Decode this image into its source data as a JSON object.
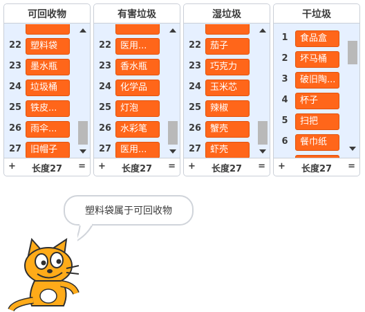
{
  "monitors": [
    {
      "title": "可回收物",
      "partial_label": "",
      "rows": [
        {
          "index": "22",
          "value": "塑料袋"
        },
        {
          "index": "23",
          "value": "墨水瓶"
        },
        {
          "index": "24",
          "value": "垃圾桶"
        },
        {
          "index": "25",
          "value": "铁皮..."
        },
        {
          "index": "26",
          "value": "雨伞..."
        },
        {
          "index": "27",
          "value": "旧帽子"
        }
      ],
      "footer": {
        "plus": "+",
        "length_label": "长度27",
        "equals": "="
      }
    },
    {
      "title": "有害垃圾",
      "partial_label": "",
      "rows": [
        {
          "index": "22",
          "value": "医用..."
        },
        {
          "index": "23",
          "value": "香水瓶"
        },
        {
          "index": "24",
          "value": "化学品"
        },
        {
          "index": "25",
          "value": "灯泡"
        },
        {
          "index": "26",
          "value": "水彩笔"
        },
        {
          "index": "27",
          "value": "医用..."
        }
      ],
      "footer": {
        "plus": "+",
        "length_label": "长度27",
        "equals": "="
      }
    },
    {
      "title": "湿垃圾",
      "partial_label": "",
      "rows": [
        {
          "index": "22",
          "value": "茄子"
        },
        {
          "index": "23",
          "value": "巧克力"
        },
        {
          "index": "24",
          "value": "玉米芯"
        },
        {
          "index": "25",
          "value": "辣椒"
        },
        {
          "index": "26",
          "value": "蟹壳"
        },
        {
          "index": "27",
          "value": "虾壳"
        }
      ],
      "footer": {
        "plus": "+",
        "length_label": "长度27",
        "equals": "="
      }
    },
    {
      "title": "干垃圾",
      "partial_label": "",
      "rows": [
        {
          "index": "1",
          "value": "食品盒"
        },
        {
          "index": "2",
          "value": "坏马桶"
        },
        {
          "index": "3",
          "value": "破旧陶..."
        },
        {
          "index": "4",
          "value": "杯子"
        },
        {
          "index": "5",
          "value": "扫把"
        },
        {
          "index": "6",
          "value": "餐巾纸"
        }
      ],
      "footer": {
        "plus": "+",
        "length_label": "长度27",
        "equals": "="
      }
    }
  ],
  "speech_bubble": "塑料袋属于可回收物",
  "colors": {
    "item_fill": "#ff661a",
    "monitor_bg": "#e6f0ff",
    "header_bg": "#ffffff",
    "border": "#c9ced6",
    "cat_orange": "#ffab19"
  },
  "sprite": {
    "name": "cat-sprite-icon"
  }
}
